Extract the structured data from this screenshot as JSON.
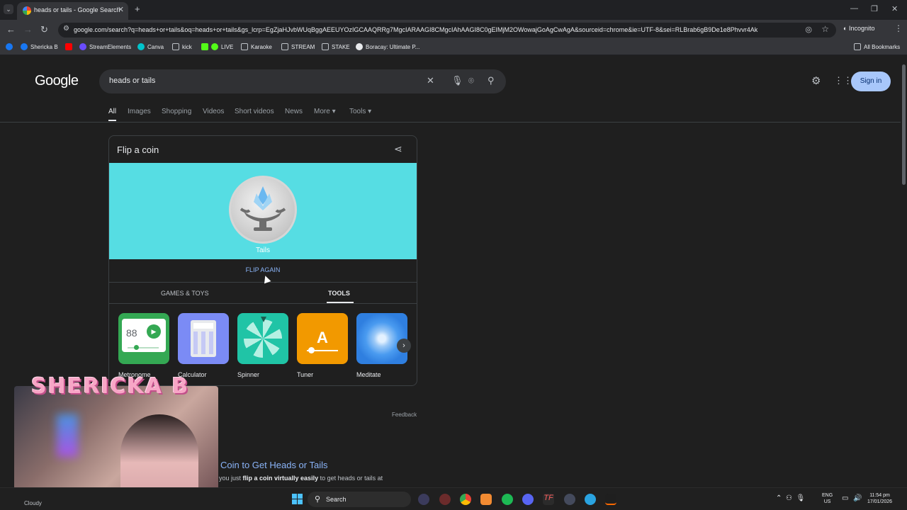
{
  "browser": {
    "tab_title": "heads or tails - Google Search",
    "url": "google.com/search?q=heads+or+tails&oq=heads+or+tails&gs_lcrp=EgZjaHJvbWUqBggAEEUYOzIGCAAQRRg7MgcIARAAGI8CMgcIAhAAGI8C0gEIMjM2OWowajGoAgCwAgA&sourceid=chrome&ie=UTF-8&sei=RLBrab6gB9De1e8Phvvr4Ak",
    "incognito_label": "Incognito",
    "bookmarks": [
      "Shericka B",
      "StreamElements",
      "Canva",
      "kick",
      "LIVE",
      "Karaoke",
      "STREAM",
      "STAKE",
      "Boracay: Ultimate P..."
    ],
    "all_bookmarks": "All Bookmarks"
  },
  "google": {
    "logo": "Google",
    "query": "heads or tails",
    "sign_in": "Sign in",
    "tabs": [
      "All",
      "Images",
      "Shopping",
      "Videos",
      "Short videos",
      "News",
      "More",
      "Tools"
    ]
  },
  "coin_card": {
    "title": "Flip a coin",
    "result": "Tails",
    "flip_again": "FLIP AGAIN",
    "category_tabs": [
      "GAMES & TOYS",
      "TOOLS"
    ],
    "tools": [
      {
        "label": "Metronome",
        "color": "#34a853",
        "display": "88"
      },
      {
        "label": "Calculator",
        "color": "#7b8bf5"
      },
      {
        "label": "Spinner",
        "color": "#20c4a6"
      },
      {
        "label": "Tuner",
        "color": "#f29900",
        "display": "A"
      },
      {
        "label": "Meditate",
        "color": "#4a9bf0"
      }
    ],
    "feedback": "Feedback"
  },
  "result": {
    "title": "Coin to Get Heads or Tails",
    "snippet_pre": "you just ",
    "snippet_bold": "flip a coin virtually easily",
    "snippet_post": " to get heads or tails at"
  },
  "overlay": {
    "streamer_name": "SHERICKA B"
  },
  "taskbar": {
    "weather": "Cloudy",
    "search": "Search",
    "lang_line1": "ENG",
    "lang_line2": "US",
    "time": "11:54 pm",
    "date": "17/01/2026"
  }
}
